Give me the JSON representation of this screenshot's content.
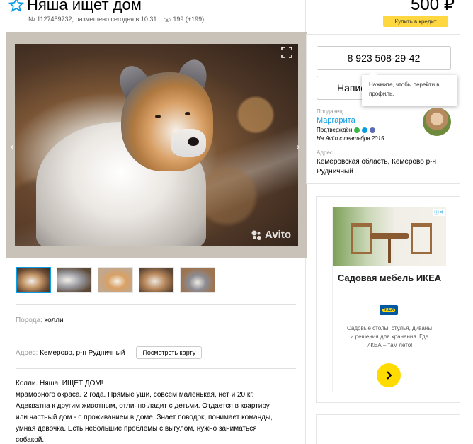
{
  "listing": {
    "title": "Няша ищет дом",
    "meta_info": "№ 1127459732, размещено сегодня в 10:31",
    "views": "199 (+199)",
    "price": "500 ₽",
    "credit_button": "Купить в кредит"
  },
  "gallery": {
    "watermark": "Avito",
    "prev_arrow": "‹",
    "next_arrow": "›",
    "thumbnail_count": 5
  },
  "properties": {
    "breed_label": "Порода:",
    "breed_value": "колли",
    "address_label": "Адрес:",
    "address_value": "Кемерово, р-н Рудничный",
    "map_button": "Посмотреть карту"
  },
  "description": {
    "lines": [
      "Колли. Няша. ИЩЕТ ДОМ!",
      "мраморного окраса. 2 года. Прямые уши, совсем маленькая, нет и 20 кг.",
      "Адекватна к другим животным, отлично ладит с детьми. Отдается в квартиру",
      "или частный дом - с проживанием в доме. Знает поводок, понимает команды,",
      "умная девочка. Есть небольшие проблемы с выгулом, нужно заниматься",
      "собакой."
    ]
  },
  "contact": {
    "phone": "8 923 508-29-42",
    "write_button": "Написать",
    "tooltip": "Нажмите, чтобы перейти в профиль.",
    "seller_label": "Продавец",
    "seller_name": "Маргарита",
    "verified": "Подтверждён",
    "since": "На Avito с сентября 2015",
    "address_label": "Адрес",
    "address": "Кемеровская область, Кемерово р-н Рудничный",
    "verify_colors": [
      "#3cb44a",
      "#0a9ce2",
      "#5b6fb5"
    ]
  },
  "ad": {
    "title": "Садовая мебель ИКЕА",
    "brand": "IKEA",
    "text": "Садовые столы, стулья, диваны и решения для хранения. Где ИКЕА – там лето!",
    "badge": "ⓘ✕"
  },
  "colors": {
    "accent_blue": "#0a9ce2",
    "credit_yellow": "#ffd740",
    "ad_yellow": "#ffdb00"
  }
}
